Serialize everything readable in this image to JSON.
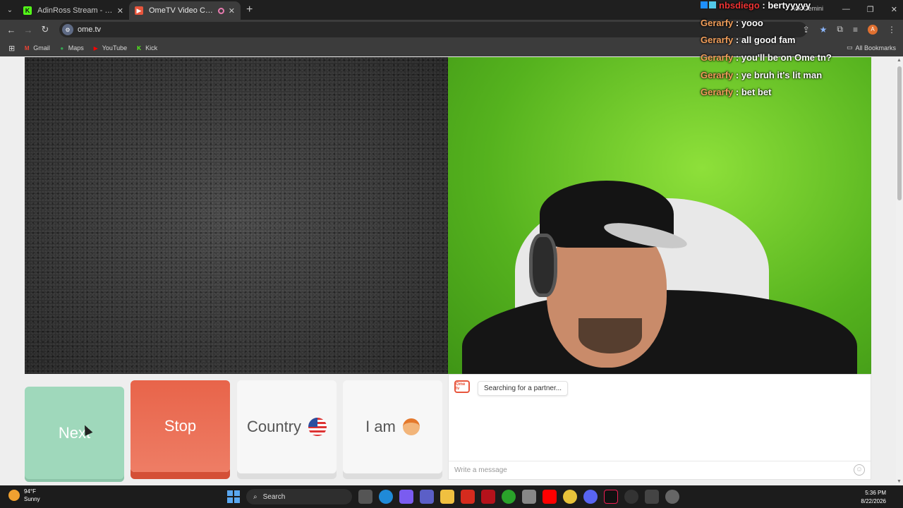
{
  "browser": {
    "tabs": [
      {
        "title": "AdinRoss Stream - Watch Live o",
        "favicon": "K",
        "favicon_color": "#53fc18",
        "active": false
      },
      {
        "title": "OmeTV Video Chat — Ome",
        "favicon": "▶",
        "favicon_color": "#e7553c",
        "active": true
      }
    ],
    "new_tab": "+",
    "url": "ome.tv",
    "bookmarks": [
      {
        "label": "Gmail",
        "icon": "M",
        "color": "#ea4335"
      },
      {
        "label": "Maps",
        "icon": "●",
        "color": "#34a853"
      },
      {
        "label": "YouTube",
        "icon": "▶",
        "color": "#ff0000"
      },
      {
        "label": "Kick",
        "icon": "K",
        "color": "#53fc18"
      }
    ],
    "all_bookmarks": "All Bookmarks",
    "profile_initial": "A"
  },
  "ome": {
    "buttons": {
      "next": "Next",
      "stop": "Stop",
      "country": "Country",
      "iam": "I am"
    },
    "logo_text": "Ome tv",
    "status": "Searching for a partner...",
    "message_placeholder": "Write a message"
  },
  "stream_chat": [
    {
      "user": "nbsdiego",
      "message": "bertyyyyy",
      "color": "#e33"
    },
    {
      "user": "Gerarfy",
      "message": "yooo",
      "color": "#f29f5b"
    },
    {
      "user": "Gerarfy",
      "message": "all good fam",
      "color": "#f29f5b"
    },
    {
      "user": "Gerarfy",
      "message": "you'll be on Ome tn?",
      "color": "#f29f5b"
    },
    {
      "user": "Gerarfy",
      "message": "ye bruh it's lit man",
      "color": "#f29f5b"
    },
    {
      "user": "Gerarfy",
      "message": "bet bet",
      "color": "#f29f5b"
    }
  ],
  "ask_gemini": "Ask Gemini",
  "taskbar": {
    "temp": "94°F",
    "weather": "Sunny",
    "search": "Search",
    "time": "5:36 PM",
    "date": "8/22/2026"
  }
}
